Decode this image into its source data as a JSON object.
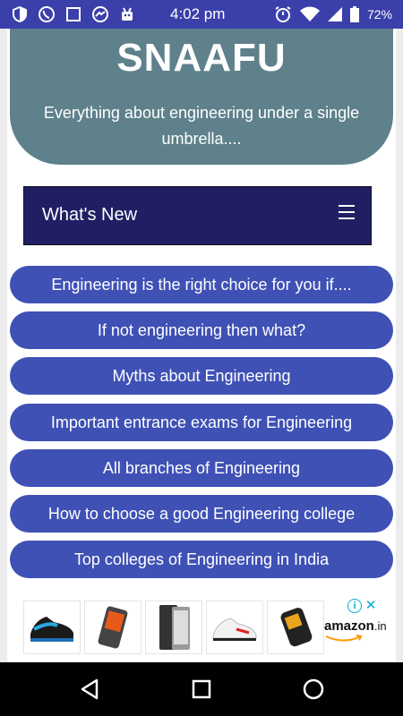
{
  "status_bar": {
    "time": "4:02 pm",
    "battery": "72%",
    "icons_left": [
      "shield-icon",
      "whatsapp-icon",
      "square-icon",
      "messenger-icon",
      "android-bug-icon"
    ],
    "icons_right": [
      "alarm-icon",
      "wifi-icon",
      "signal-icon",
      "battery-icon"
    ]
  },
  "header": {
    "title": "SNAAFU",
    "tagline": "Everything about engineering under a single umbrella...."
  },
  "nav": {
    "title": "What's New",
    "menu_icon": "hamburger-icon"
  },
  "links": [
    "Engineering is the right choice for you if....",
    "If not engineering then what?",
    "Myths about Engineering",
    "Important entrance exams for Engineering",
    "All branches of Engineering",
    "How to choose a good Engineering college",
    "Top colleges of Engineering in India"
  ],
  "ad": {
    "items": [
      "shoe-product",
      "phone-product",
      "phone-product",
      "shoe-product",
      "phone-product"
    ],
    "brand": "amazon",
    "brand_tld": ".in"
  },
  "colors": {
    "status_bar": "#3b3faa",
    "header": "#5e818b",
    "nav": "#201f64",
    "link_button": "#3f51b5"
  }
}
